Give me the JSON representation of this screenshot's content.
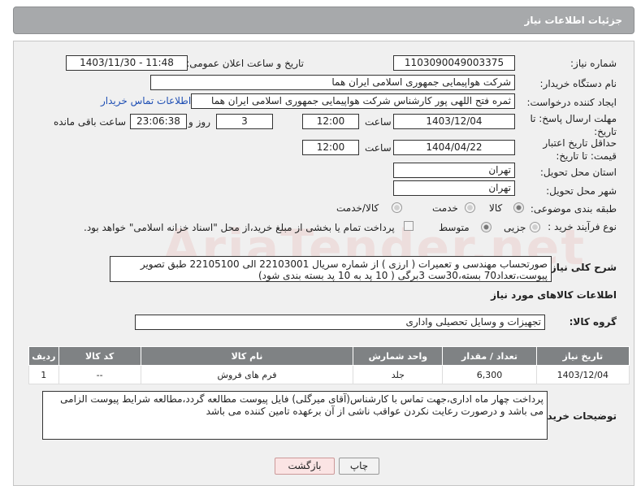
{
  "header": {
    "title": "جزئیات اطلاعات نیاز"
  },
  "form": {
    "need_number": {
      "label": "شماره نیاز:",
      "value": "1103090049003375"
    },
    "announce": {
      "label": "تاریخ و ساعت اعلان عمومی:",
      "value": "1403/11/30 - 11:48"
    },
    "buyer_org": {
      "label": "نام دستگاه خریدار:",
      "value": "شرکت هواپیمایی جمهوری اسلامی ایران هما"
    },
    "requester": {
      "label": "ایجاد کننده درخواست:",
      "value": "ثمره فتح اللهی پور کارشناس شرکت هواپیمایی جمهوری اسلامی ایران هما",
      "contact_link": "اطلاعات تماس خریدار"
    },
    "reply_deadline": {
      "label": "مهلت ارسال پاسخ: تا تاریخ:",
      "date": "1403/12/04",
      "time_label": "ساعت",
      "time": "12:00",
      "days": "3",
      "days_label": "روز و",
      "remaining": "23:06:38",
      "remaining_label": "ساعت باقی مانده"
    },
    "price_validity": {
      "label": "حداقل تاریخ اعتبار قیمت: تا تاریخ:",
      "date": "1404/04/22",
      "time_label": "ساعت",
      "time": "12:00"
    },
    "province": {
      "label": "استان محل تحویل:",
      "value": "تهران"
    },
    "city": {
      "label": "شهر محل تحویل:",
      "value": "تهران"
    },
    "category": {
      "label": "طبقه بندی موضوعی:",
      "options": [
        "کالا",
        "خدمت",
        "کالا/خدمت"
      ],
      "selected": 0
    },
    "process": {
      "label": "نوع فرآیند خرید :",
      "options": [
        "جزیی",
        "متوسط"
      ],
      "selected": 1,
      "payment_note": "پرداخت تمام یا بخشی از مبلغ خرید،از محل \"اسناد خزانه اسلامی\" خواهد بود."
    },
    "description": {
      "label": "شرح کلی نیاز:",
      "value": "صورتحساب مهندسی و تعمیرات ( ارزی ) از شماره سریال 22103001 الی  22105100 طبق تصویر پیوست،تعداد70 بسته،30ست 3برگی ( 10 پد به 10 پد بسته بندی شود)"
    }
  },
  "goods": {
    "section_title": "اطلاعات کالاهای مورد نیاز",
    "group_label": "گروه کالا:",
    "group_value": "تجهیزات و وسایل تحصیلی واداری",
    "columns": [
      "ردیف",
      "کد کالا",
      "نام کالا",
      "واحد شمارش",
      "تعداد / مقدار",
      "تاریخ نیاز"
    ],
    "rows": [
      [
        "1",
        "--",
        "فرم های فروش",
        "جلد",
        "6,300",
        "1403/12/04"
      ]
    ]
  },
  "buyer_notes": {
    "label": "توضیحات خریدار:",
    "value": "پرداخت چهار ماه اداری،جهت تماس با کارشناس(آقای میرگلی) فایل پیوست مطالعه گردد،مطالعه شرایط پیوست الزامی می باشد و درصورت رعایت نکردن عواقب ناشی از آن برعهده تامین کننده می باشد"
  },
  "buttons": {
    "print": "چاپ",
    "back": "بازگشت"
  },
  "watermark": "AriaTender.net"
}
